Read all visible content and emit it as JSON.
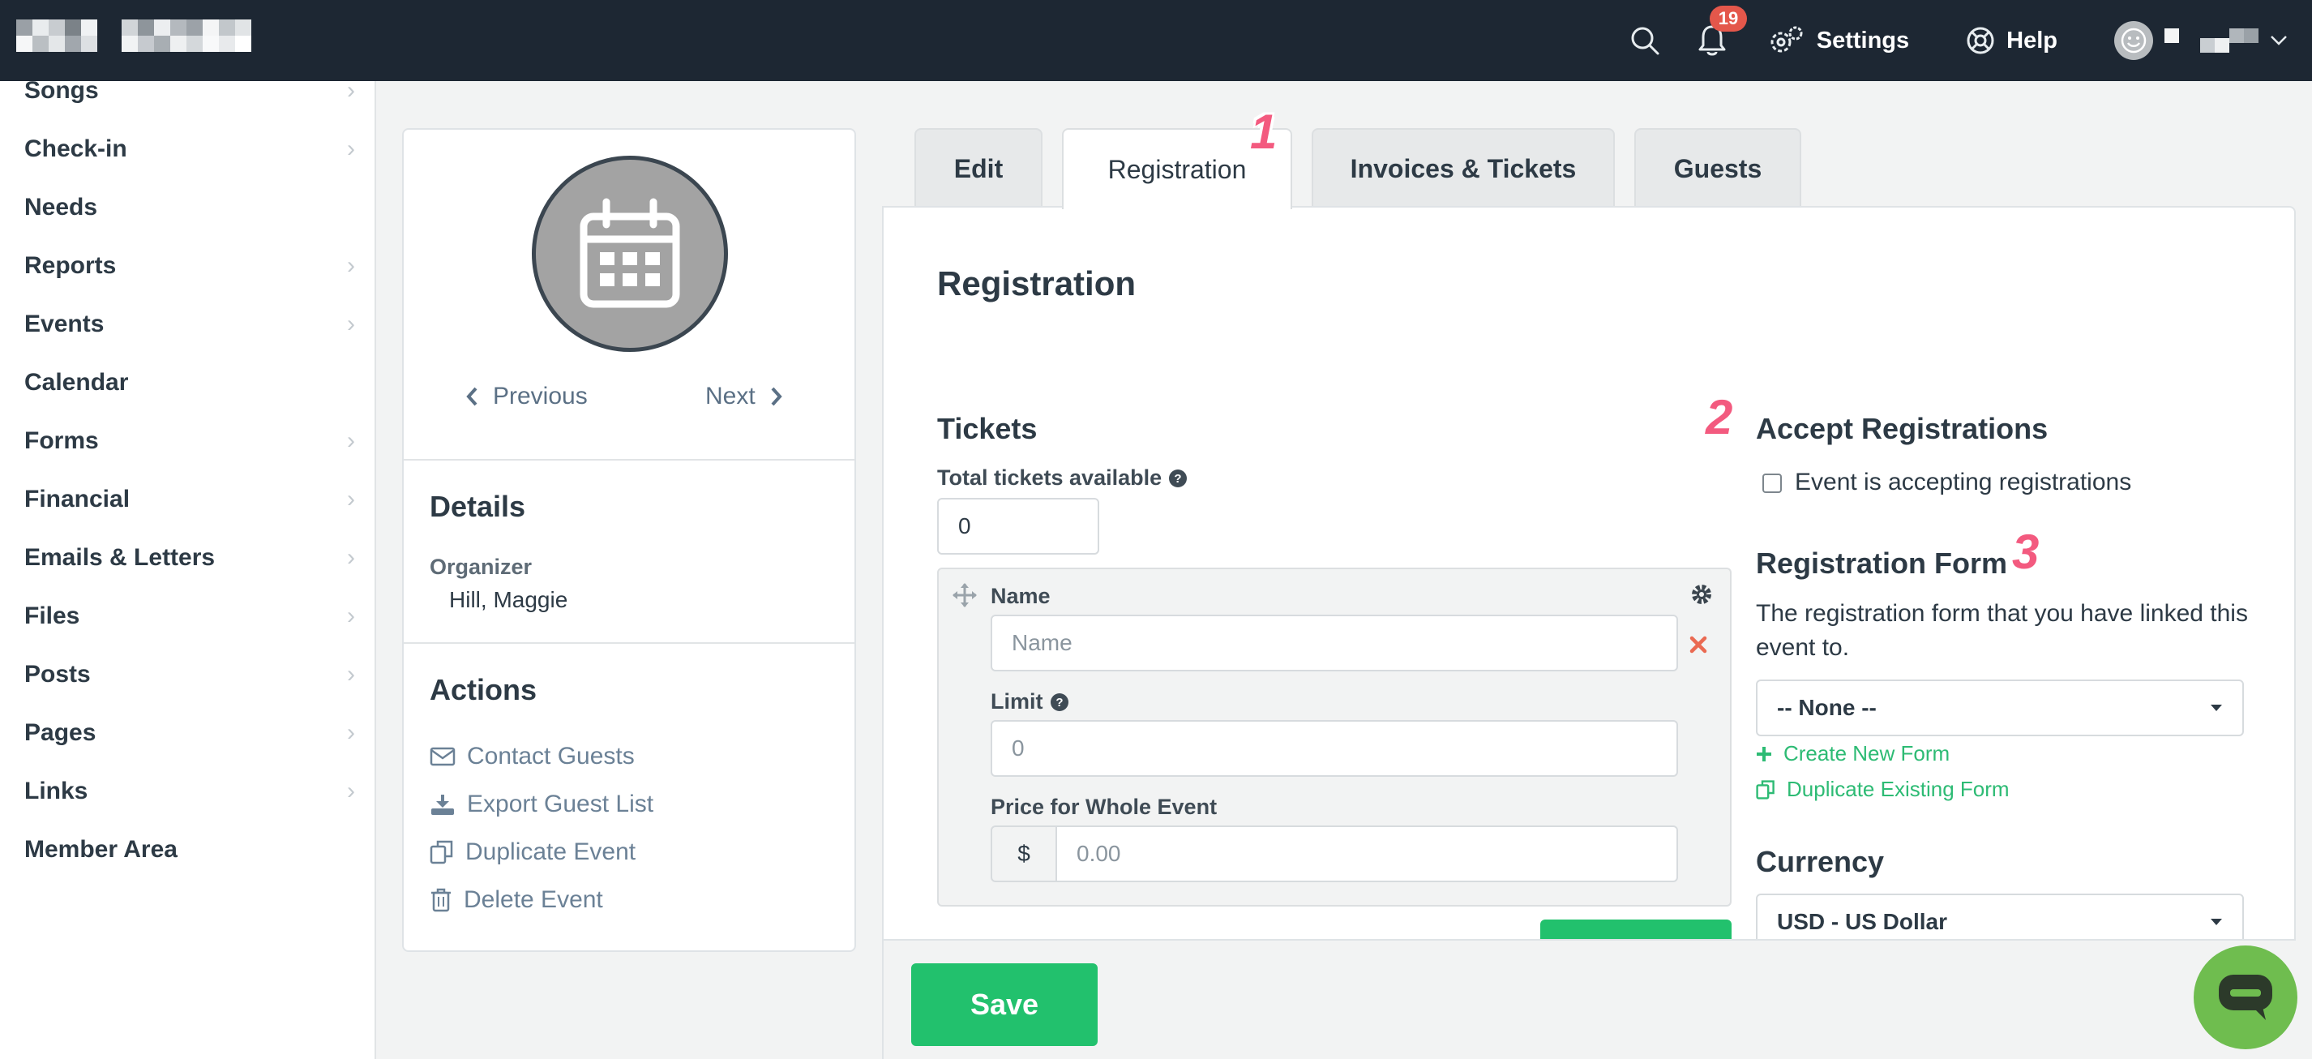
{
  "topbar": {
    "notification_count": "19",
    "settings_label": "Settings",
    "help_label": "Help",
    "icons": [
      "search-icon",
      "bell-icon",
      "gears-icon",
      "lifebuoy-icon",
      "smiley-avatar-icon",
      "chevron-down-icon"
    ]
  },
  "sidebar": {
    "items": [
      {
        "label": "Songs",
        "has_submenu": true
      },
      {
        "label": "Check-in",
        "has_submenu": true
      },
      {
        "label": "Needs",
        "has_submenu": false
      },
      {
        "label": "Reports",
        "has_submenu": true
      },
      {
        "label": "Events",
        "has_submenu": true
      },
      {
        "label": "Calendar",
        "has_submenu": false
      },
      {
        "label": "Forms",
        "has_submenu": true
      },
      {
        "label": "Financial",
        "has_submenu": true
      },
      {
        "label": "Emails & Letters",
        "has_submenu": true
      },
      {
        "label": "Files",
        "has_submenu": true
      },
      {
        "label": "Posts",
        "has_submenu": true
      },
      {
        "label": "Pages",
        "has_submenu": true
      },
      {
        "label": "Links",
        "has_submenu": true
      },
      {
        "label": "Member Area",
        "has_submenu": false
      }
    ]
  },
  "event_card": {
    "previous_label": "Previous",
    "next_label": "Next",
    "details_heading": "Details",
    "organizer_label": "Organizer",
    "organizer_value": "Hill, Maggie",
    "actions_heading": "Actions",
    "actions": [
      {
        "label": "Contact Guests",
        "icon": "envelope-icon"
      },
      {
        "label": "Export Guest List",
        "icon": "download-icon"
      },
      {
        "label": "Duplicate Event",
        "icon": "copy-icon"
      },
      {
        "label": "Delete Event",
        "icon": "trash-icon"
      }
    ]
  },
  "tabs": [
    {
      "label": "Edit",
      "active": false
    },
    {
      "label": "Registration",
      "active": true
    },
    {
      "label": "Invoices & Tickets",
      "active": false
    },
    {
      "label": "Guests",
      "active": false
    }
  ],
  "step_markers": [
    "1",
    "2",
    "3"
  ],
  "registration": {
    "title": "Registration",
    "tickets_heading": "Tickets",
    "total_tickets_label": "Total tickets available",
    "total_tickets_value": "0",
    "ticket": {
      "name_label": "Name",
      "name_placeholder": "Name",
      "limit_label": "Limit",
      "limit_placeholder": "0",
      "price_label": "Price for Whole Event",
      "currency_symbol": "$",
      "price_placeholder": "0.00"
    },
    "accept_heading": "Accept Registrations",
    "accept_checkbox_label": "Event is accepting registrations",
    "accept_checked": false,
    "form_heading": "Registration Form",
    "form_description": "The registration form that you have linked this event to.",
    "form_selected": "-- None --",
    "create_form_label": "Create New Form",
    "duplicate_form_label": "Duplicate Existing Form",
    "currency_heading": "Currency",
    "currency_selected": "USD - US Dollar"
  },
  "footer": {
    "save_label": "Save"
  },
  "colors": {
    "topbar_bg": "#1d2733",
    "accent_green": "#22c16d",
    "link_green": "#2dbb74",
    "step_pink": "#f35a7f",
    "badge_red": "#e4574b",
    "chat_green": "#6fbd4f"
  }
}
